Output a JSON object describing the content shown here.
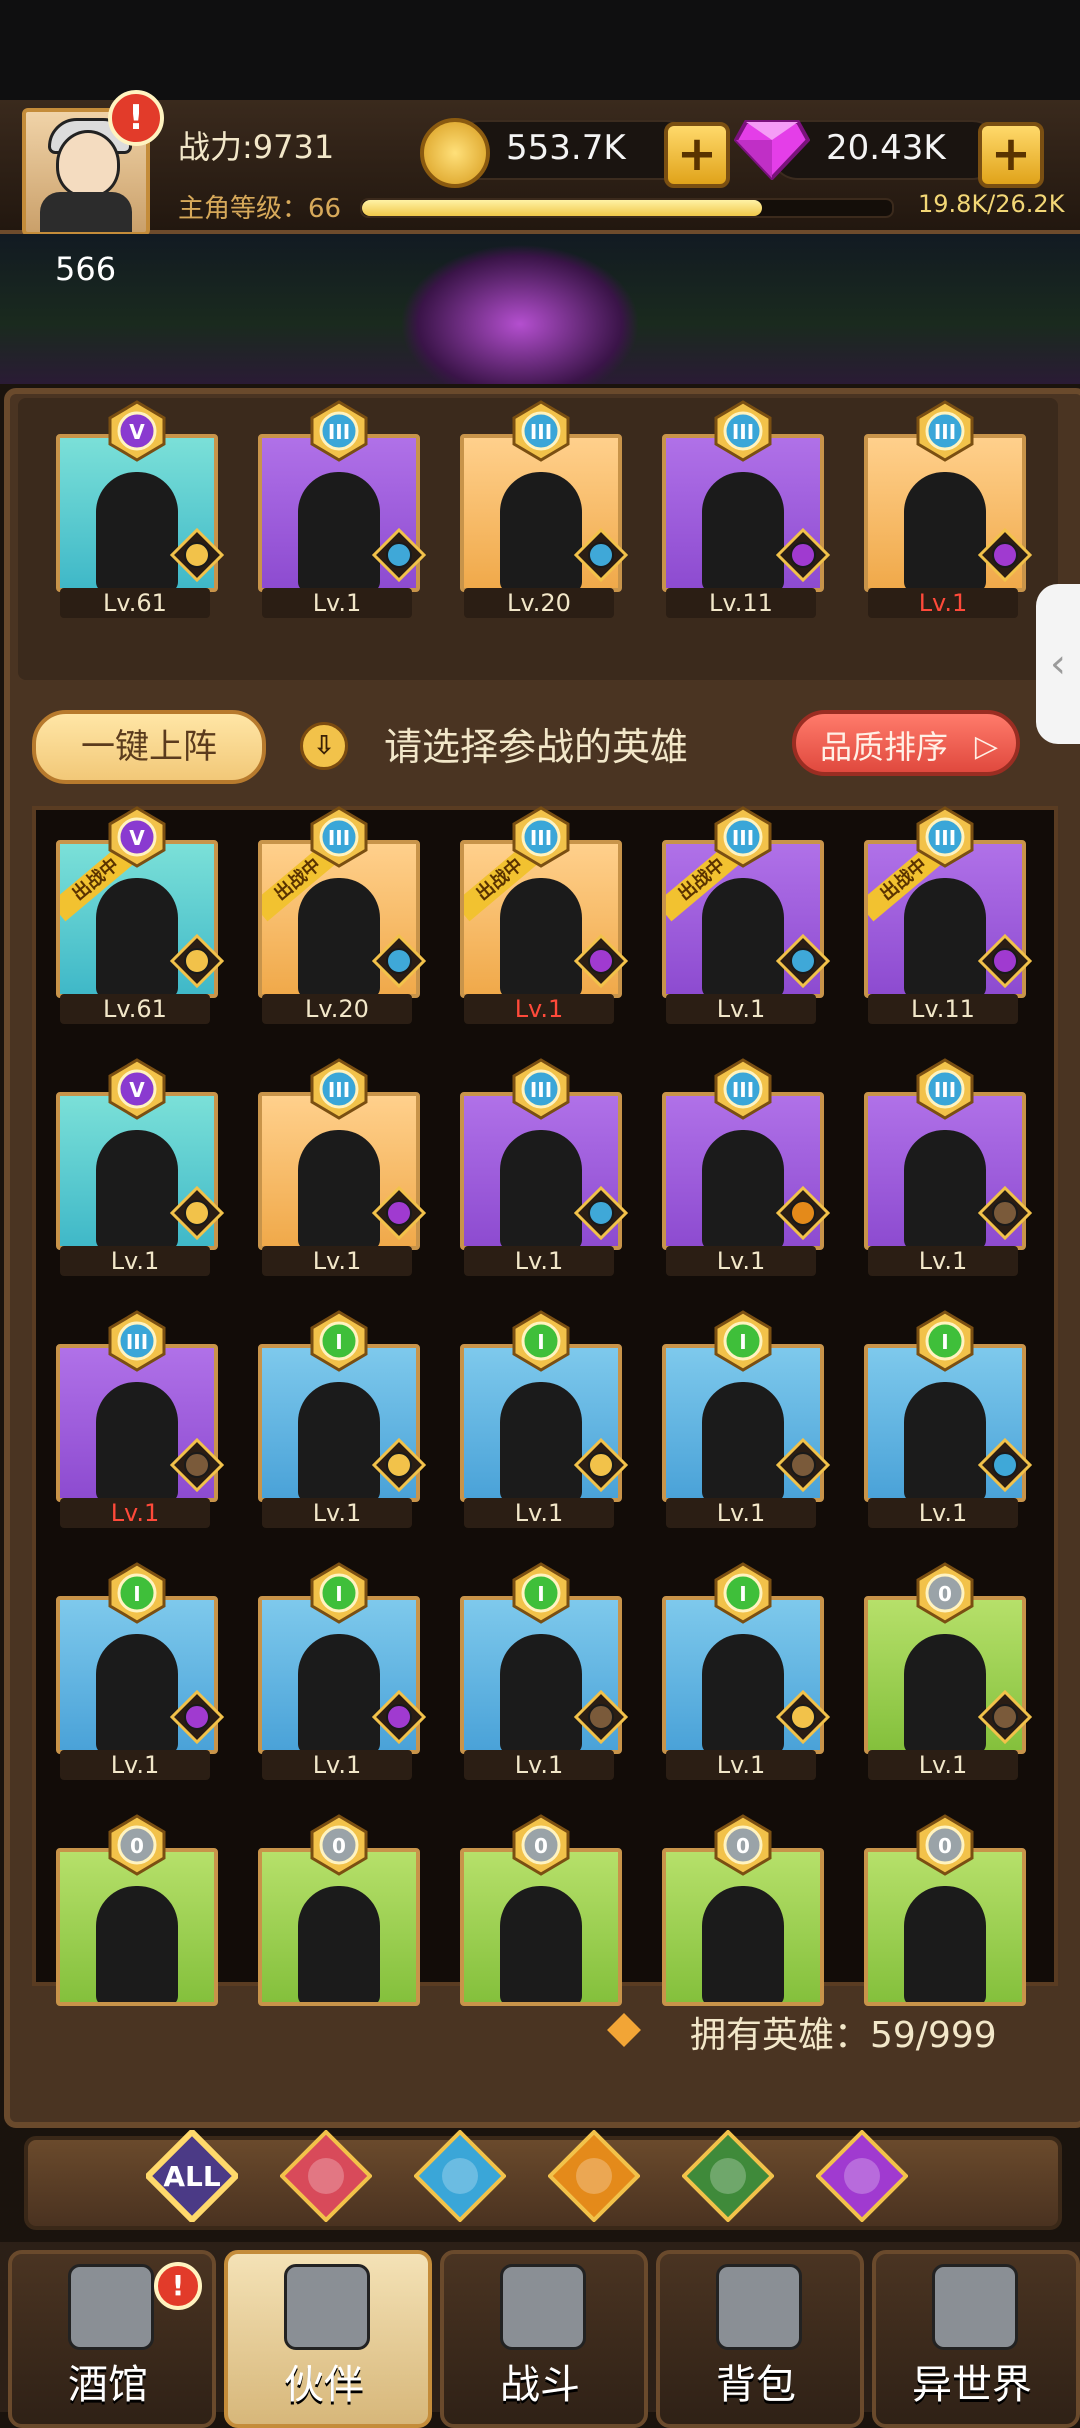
{
  "header": {
    "combat_power": "战力:9731",
    "level_label": "主角等级：",
    "level_value": "66",
    "xp_text": "19.8K/26.2K",
    "xp_fraction": 0.755,
    "gold": "553.7K",
    "gems": "20.43K",
    "hero_id_number": "566"
  },
  "team": [
    {
      "tier": "V",
      "bg": "cyan",
      "level": "Lv.61",
      "faction": "elf",
      "red": false
    },
    {
      "tier": "III",
      "bg": "purple",
      "level": "Lv.1",
      "faction": "fish",
      "red": false
    },
    {
      "tier": "III",
      "bg": "orange",
      "level": "Lv.20",
      "faction": "fish",
      "red": false
    },
    {
      "tier": "III",
      "bg": "purple",
      "level": "Lv.11",
      "faction": "demon",
      "red": false
    },
    {
      "tier": "III",
      "bg": "orange",
      "level": "Lv.1",
      "faction": "demon",
      "red": true
    }
  ],
  "controls": {
    "auto_deploy": "一键上阵",
    "hint": "请选择参战的英雄",
    "sort": "品质排序"
  },
  "deployed_ribbon": "出战中",
  "grid": [
    {
      "tier": "V",
      "bg": "cyan",
      "level": "Lv.61",
      "faction": "elf",
      "red": false,
      "deployed": true
    },
    {
      "tier": "III",
      "bg": "orange",
      "level": "Lv.20",
      "faction": "fish",
      "red": false,
      "deployed": true
    },
    {
      "tier": "III",
      "bg": "orange",
      "level": "Lv.1",
      "faction": "demon",
      "red": true,
      "deployed": true
    },
    {
      "tier": "III",
      "bg": "purple",
      "level": "Lv.1",
      "faction": "fish",
      "red": false,
      "deployed": true
    },
    {
      "tier": "III",
      "bg": "purple",
      "level": "Lv.11",
      "faction": "demon",
      "red": false,
      "deployed": true
    },
    {
      "tier": "V",
      "bg": "cyan",
      "level": "Lv.1",
      "faction": "elf",
      "red": false,
      "deployed": false
    },
    {
      "tier": "III",
      "bg": "orange",
      "level": "Lv.1",
      "faction": "demon",
      "red": false,
      "deployed": false
    },
    {
      "tier": "III",
      "bg": "purple",
      "level": "Lv.1",
      "faction": "fish",
      "red": false,
      "deployed": false
    },
    {
      "tier": "III",
      "bg": "purple",
      "level": "Lv.1",
      "faction": "lion",
      "red": false,
      "deployed": false
    },
    {
      "tier": "III",
      "bg": "purple",
      "level": "Lv.1",
      "faction": "knight",
      "red": false,
      "deployed": false
    },
    {
      "tier": "III",
      "bg": "purple",
      "level": "Lv.1",
      "faction": "knight",
      "red": true,
      "deployed": false
    },
    {
      "tier": "I",
      "bg": "blue",
      "level": "Lv.1",
      "faction": "elf",
      "red": false,
      "deployed": false
    },
    {
      "tier": "I",
      "bg": "blue",
      "level": "Lv.1",
      "faction": "elf",
      "red": false,
      "deployed": false
    },
    {
      "tier": "I",
      "bg": "blue",
      "level": "Lv.1",
      "faction": "knight",
      "red": false,
      "deployed": false
    },
    {
      "tier": "I",
      "bg": "blue",
      "level": "Lv.1",
      "faction": "fish",
      "red": false,
      "deployed": false
    },
    {
      "tier": "I",
      "bg": "blue",
      "level": "Lv.1",
      "faction": "demon",
      "red": false,
      "deployed": false
    },
    {
      "tier": "I",
      "bg": "blue",
      "level": "Lv.1",
      "faction": "demon",
      "red": false,
      "deployed": false
    },
    {
      "tier": "I",
      "bg": "blue",
      "level": "Lv.1",
      "faction": "knight",
      "red": false,
      "deployed": false
    },
    {
      "tier": "I",
      "bg": "blue",
      "level": "Lv.1",
      "faction": "elf",
      "red": false,
      "deployed": false
    },
    {
      "tier": "0",
      "bg": "green",
      "level": "Lv.1",
      "faction": "knight",
      "red": false,
      "deployed": false
    },
    {
      "tier": "0",
      "bg": "green",
      "level": "",
      "faction": "",
      "red": false,
      "deployed": false
    },
    {
      "tier": "0",
      "bg": "green",
      "level": "",
      "faction": "",
      "red": false,
      "deployed": false
    },
    {
      "tier": "0",
      "bg": "green",
      "level": "",
      "faction": "",
      "red": false,
      "deployed": false
    },
    {
      "tier": "0",
      "bg": "green",
      "level": "",
      "faction": "",
      "red": false,
      "deployed": false
    },
    {
      "tier": "0",
      "bg": "green",
      "level": "",
      "faction": "",
      "red": false,
      "deployed": false
    }
  ],
  "owned": "拥有英雄：59/999",
  "filters": [
    "ALL",
    "knight",
    "fish",
    "lion",
    "elf",
    "demon"
  ],
  "nav": [
    {
      "label": "酒馆",
      "icon": "beer-mug-icon",
      "alert": true,
      "active": false
    },
    {
      "label": "伙伴",
      "icon": "partner-icon",
      "alert": false,
      "active": true
    },
    {
      "label": "战斗",
      "icon": "crossed-swords-icon",
      "alert": false,
      "active": false
    },
    {
      "label": "背包",
      "icon": "backpack-icon",
      "alert": false,
      "active": false
    },
    {
      "label": "异世界",
      "icon": "portal-icon",
      "alert": false,
      "active": false
    }
  ]
}
